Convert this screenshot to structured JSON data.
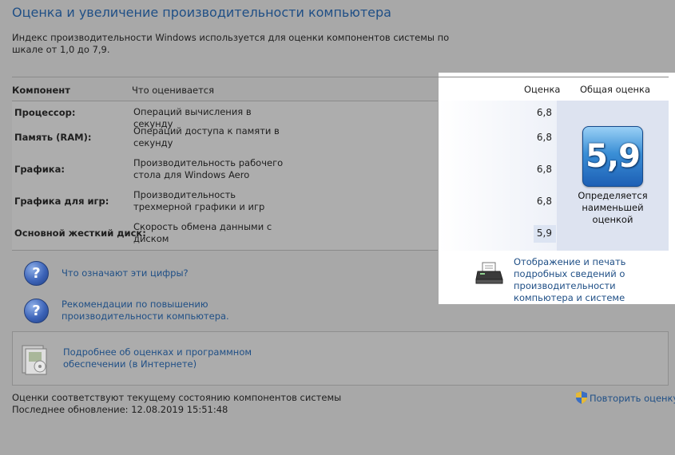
{
  "title": "Оценка и увеличение производительности компьютера",
  "description": "Индекс производительности Windows используется для оценки компонентов системы по шкале от 1,0 до 7,9.",
  "table": {
    "headers": {
      "component": "Компонент",
      "what": "Что оценивается",
      "score": "Оценка",
      "total": "Общая оценка"
    },
    "rows": [
      {
        "component": "Процессор:",
        "what": "Операций вычисления в секунду",
        "score": "6,8"
      },
      {
        "component": "Память (RAM):",
        "what": "Операций доступа к памяти в секунду",
        "score": "6,8"
      },
      {
        "component": "Графика:",
        "what": "Производительность рабочего стола для Windows Aero",
        "score": "6,8"
      },
      {
        "component": "Графика для игр:",
        "what": "Производительность трехмерной графики и игр",
        "score": "6,8"
      },
      {
        "component": "Основной жесткий диск:",
        "what": "Скорость обмена данными с диском",
        "score": "5,9"
      }
    ],
    "base_score": "5,9",
    "base_score_caption": "Определяется наименьшей оценкой"
  },
  "links": {
    "what_numbers": "Что означают эти цифры?",
    "recommendations": "Рекомендации по повышению производительности компьютера.",
    "print_details": "Отображение и печать подробных сведений о производительности компьютера и системе",
    "more_info": "Подробнее об оценках и программном обеспечении (в Интернете)",
    "rerun": "Повторить оценку"
  },
  "status": {
    "line1": "Оценки соответствуют текущему состоянию компонентов системы",
    "line2": "Последнее обновление: 12.08.2019 15:51:48"
  },
  "icons": {
    "help": "question-icon",
    "printer": "printer-icon",
    "software": "software-box-icon",
    "shield": "uac-shield-icon"
  },
  "colors": {
    "link": "#1f4f86",
    "background": "#a8a8a8",
    "score_badge": "#2f7fd0"
  }
}
